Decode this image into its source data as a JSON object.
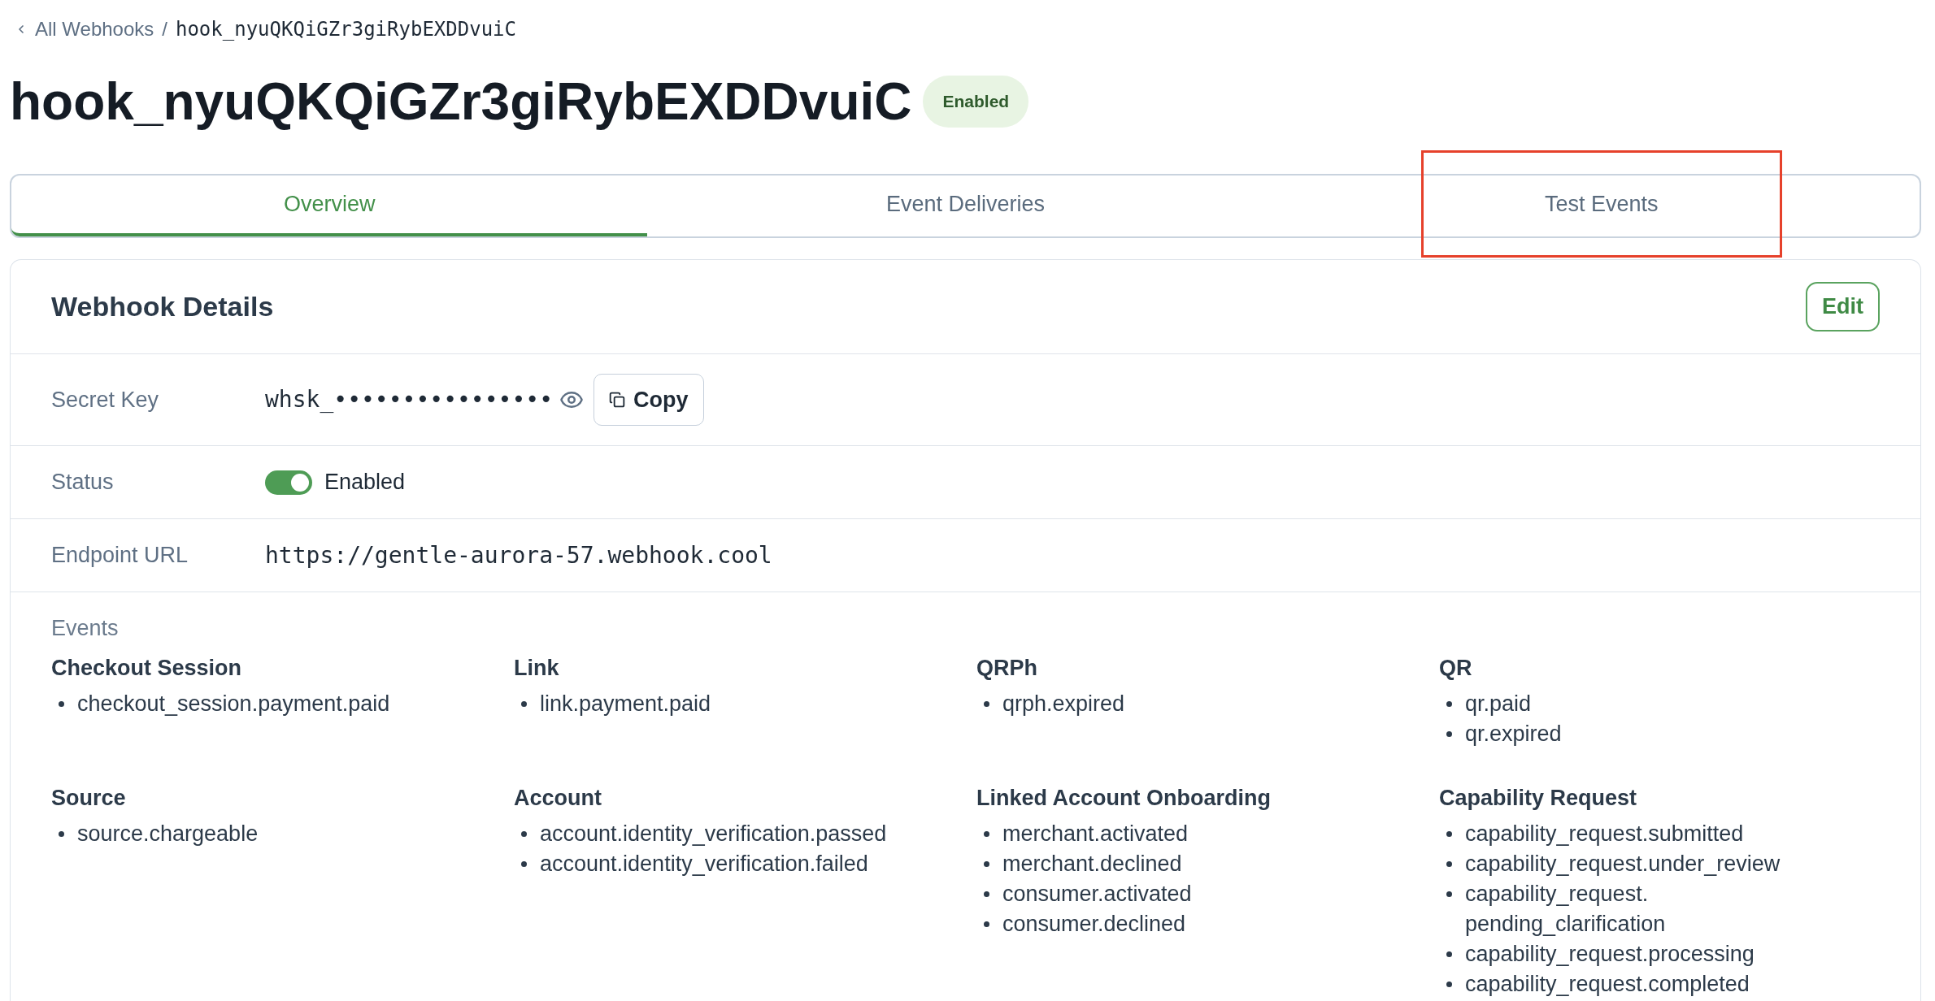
{
  "breadcrumb": {
    "parent": "All Webhooks",
    "separator": "/",
    "current": "hook_nyuQKQiGZr3giRybEXDDvuiC"
  },
  "title": "hook_nyuQKQiGZr3giRybEXDDvuiC",
  "status_badge": "Enabled",
  "tabs": [
    {
      "label": "Overview",
      "selected": true,
      "annotated": false
    },
    {
      "label": "Event Deliveries",
      "selected": false,
      "annotated": false
    },
    {
      "label": "Test Events",
      "selected": false,
      "annotated": true
    }
  ],
  "details": {
    "title": "Webhook Details",
    "edit_button": "Edit",
    "fields": [
      {
        "kind": "secret",
        "label": "Secret Key",
        "value": "whsk_••••••••••••••••",
        "copy_button": "Copy"
      },
      {
        "kind": "switch",
        "label": "Status",
        "on": true,
        "text": "Enabled"
      },
      {
        "kind": "url",
        "label": "Endpoint URL",
        "value": "https://gentle-aurora-57.webhook.cool"
      }
    ],
    "events": {
      "label": "Events",
      "groups": [
        {
          "name": "Checkout Session",
          "items": [
            "checkout_session.payment.paid"
          ]
        },
        {
          "name": "Link",
          "items": [
            "link.payment.paid"
          ]
        },
        {
          "name": "QRPh",
          "items": [
            "qrph.expired"
          ]
        },
        {
          "name": "QR",
          "items": [
            "qr.paid",
            "qr.expired"
          ]
        },
        {
          "name": "Source",
          "items": [
            "source.chargeable"
          ]
        },
        {
          "name": "Account",
          "items": [
            "account.identity_verification.passed",
            "account.identity_verification.failed"
          ]
        },
        {
          "name": "Linked Account Onboarding",
          "items": [
            "merchant.activated",
            "merchant.declined",
            "consumer.activated",
            "consumer.declined"
          ]
        },
        {
          "name": "Capability Request",
          "items": [
            "capability_request.submitted",
            "capability_request.under_review",
            "capability_request.pending_clarification",
            "capability_request.processing",
            "capability_request.completed"
          ]
        }
      ]
    }
  }
}
